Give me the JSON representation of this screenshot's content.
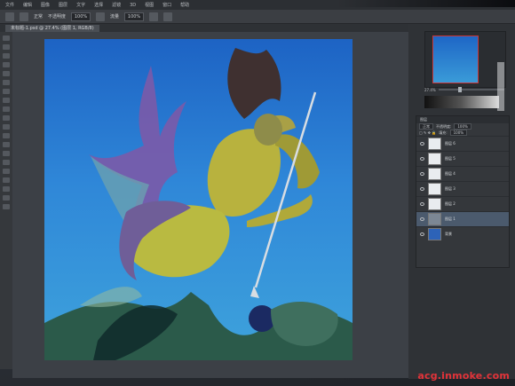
{
  "menu": {
    "items": [
      "文件",
      "编辑",
      "图像",
      "图层",
      "文字",
      "选择",
      "滤镜",
      "3D",
      "视图",
      "窗口",
      "帮助"
    ]
  },
  "options_bar": {
    "mode_label": "正常",
    "opacity_label": "不透明度",
    "opacity_value": "100%",
    "flow_label": "流量",
    "flow_value": "100%"
  },
  "document": {
    "tab_label": "未标题-1.psd @ 27.4% (图层 1, RGB/8)"
  },
  "navigator": {
    "zoom_value": "27.4%"
  },
  "layers_panel": {
    "tab_label": "图层",
    "blend_mode": "正常",
    "opacity_label": "不透明度:",
    "opacity_value": "100%",
    "fill_label": "填充:",
    "fill_value": "100%",
    "layers": [
      {
        "name": "图层 6",
        "thumb": "light"
      },
      {
        "name": "图层 5",
        "thumb": "light"
      },
      {
        "name": "图层 4",
        "thumb": "light"
      },
      {
        "name": "图层 3",
        "thumb": "light"
      },
      {
        "name": "图层 2",
        "thumb": "light"
      },
      {
        "name": "图层 1",
        "thumb": "dark"
      },
      {
        "name": "背景",
        "thumb": "blue"
      }
    ]
  },
  "watermark": {
    "text": "acg.inmoke.com"
  },
  "colors": {
    "canvas_bg": "#2f87d8",
    "selection": "#4b5a6d",
    "watermark": "#e23339"
  }
}
